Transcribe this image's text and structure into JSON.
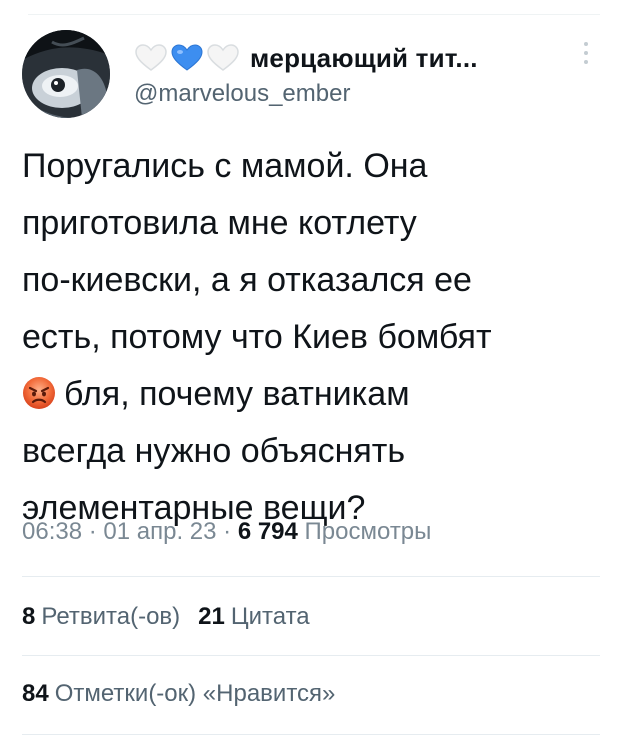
{
  "author": {
    "display_name": "мерцающий тит...",
    "handle": "@marvelous_ember",
    "badge_icons": [
      "white-heart-icon",
      "blue-heart-icon",
      "white-heart-icon"
    ]
  },
  "tweet": {
    "lines": [
      "Поругались с мамой. Она",
      "приготовила мне котлету",
      "по-киевски, а я отказался ее",
      "есть, потому что Киев бомбят",
      "бля, почему ватникам",
      "всегда нужно объяснять",
      "элементарные вещи?"
    ],
    "emoji": "angry-face-icon"
  },
  "meta": {
    "time": "06:38",
    "sep1": " · ",
    "date": "01 апр. 23",
    "sep2": " · ",
    "views_count": "6 794",
    "views_label": "Просмотры"
  },
  "stats": {
    "retweets_count": "8",
    "retweets_label": "Ретвита(-ов)",
    "quotes_count": "21",
    "quotes_label": "Цитата",
    "likes_count": "84",
    "likes_label": "Отметки(-ок) «Нравится»"
  },
  "colors": {
    "text": "#0f1419",
    "secondary": "#536471",
    "blue_heart": "#3d8ef0",
    "divider": "#e6ecf0"
  }
}
